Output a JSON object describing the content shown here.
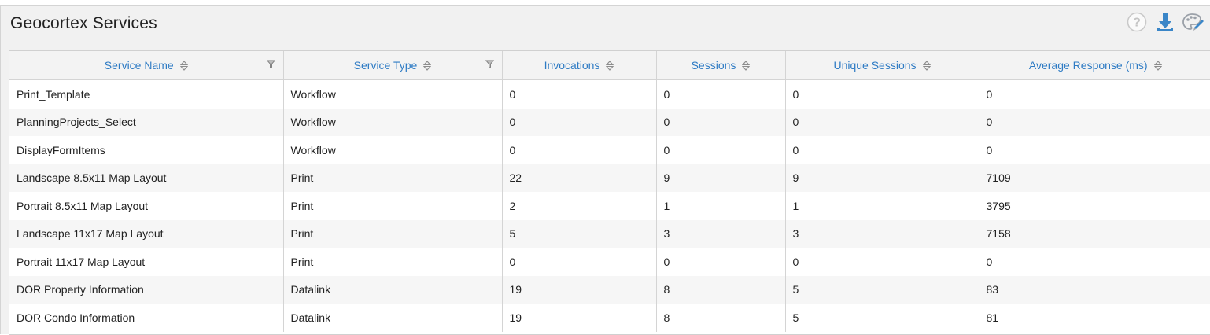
{
  "panel": {
    "title": "Geocortex Services",
    "toolbar": [
      {
        "icon": "help-icon"
      },
      {
        "icon": "download-icon"
      },
      {
        "icon": "palette-icon"
      }
    ]
  },
  "table": {
    "columns": [
      {
        "label": "Service Name",
        "sortable": true,
        "filterable": true
      },
      {
        "label": "Service Type",
        "sortable": true,
        "filterable": true
      },
      {
        "label": "Invocations",
        "sortable": true,
        "filterable": false
      },
      {
        "label": "Sessions",
        "sortable": true,
        "filterable": false
      },
      {
        "label": "Unique Sessions",
        "sortable": true,
        "filterable": false
      },
      {
        "label": "Average Response (ms)",
        "sortable": true,
        "filterable": false
      }
    ],
    "rows": [
      [
        "Print_Template",
        "Workflow",
        "0",
        "0",
        "0",
        "0"
      ],
      [
        "PlanningProjects_Select",
        "Workflow",
        "0",
        "0",
        "0",
        "0"
      ],
      [
        "DisplayFormItems",
        "Workflow",
        "0",
        "0",
        "0",
        "0"
      ],
      [
        "Landscape 8.5x11 Map Layout",
        "Print",
        "22",
        "9",
        "9",
        "7109"
      ],
      [
        "Portrait 8.5x11 Map Layout",
        "Print",
        "2",
        "1",
        "1",
        "3795"
      ],
      [
        "Landscape 11x17 Map Layout",
        "Print",
        "5",
        "3",
        "3",
        "7158"
      ],
      [
        "Portrait 11x17 Map Layout",
        "Print",
        "0",
        "0",
        "0",
        "0"
      ],
      [
        "DOR Property Information",
        "Datalink",
        "19",
        "8",
        "5",
        "83"
      ],
      [
        "DOR Condo Information",
        "Datalink",
        "19",
        "8",
        "5",
        "81"
      ]
    ]
  },
  "colors": {
    "header_text": "#2e7bc4",
    "icon_blue": "#3a86c8",
    "icon_gray": "#c4c4c4"
  }
}
